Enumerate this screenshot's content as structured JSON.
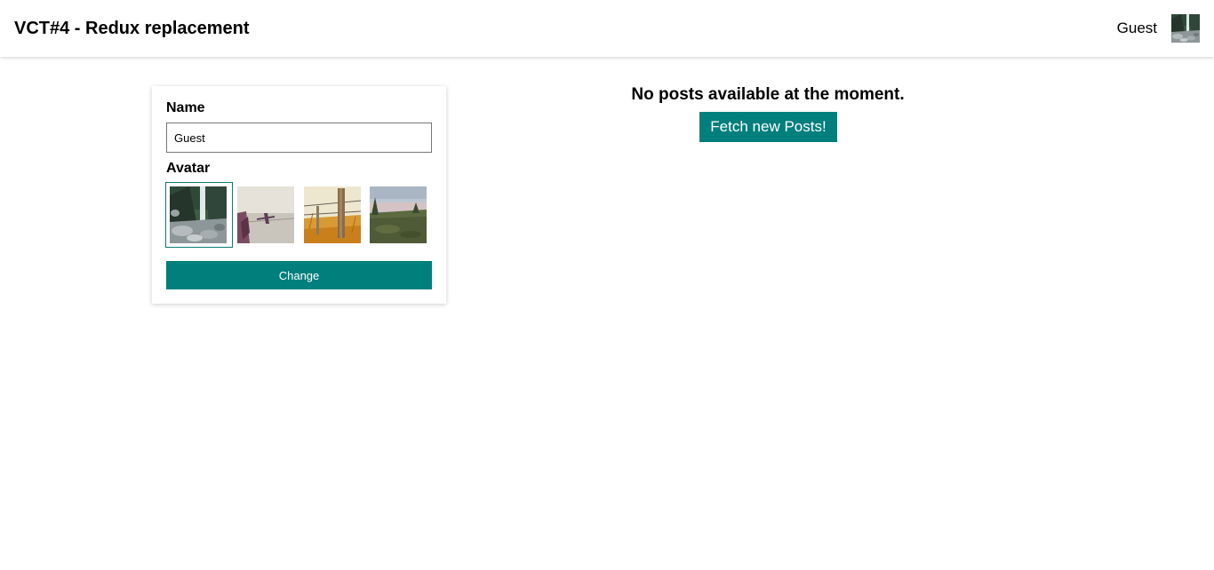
{
  "header": {
    "title": "VCT#4 - Redux replacement",
    "user_name": "Guest",
    "user_avatar": "waterfall-photo"
  },
  "profile_card": {
    "name_label": "Name",
    "name_value": "Guest",
    "avatar_label": "Avatar",
    "avatars": [
      {
        "name": "waterfall-photo",
        "selected": true
      },
      {
        "name": "airplane-window-photo",
        "selected": false
      },
      {
        "name": "fence-post-photo",
        "selected": false
      },
      {
        "name": "meadow-photo",
        "selected": false
      }
    ],
    "change_label": "Change"
  },
  "posts": {
    "empty_message": "No posts available at the moment.",
    "fetch_label": "Fetch new Posts!"
  },
  "colors": {
    "accent": "#017f7c",
    "selected_border": "#0b7a75"
  }
}
